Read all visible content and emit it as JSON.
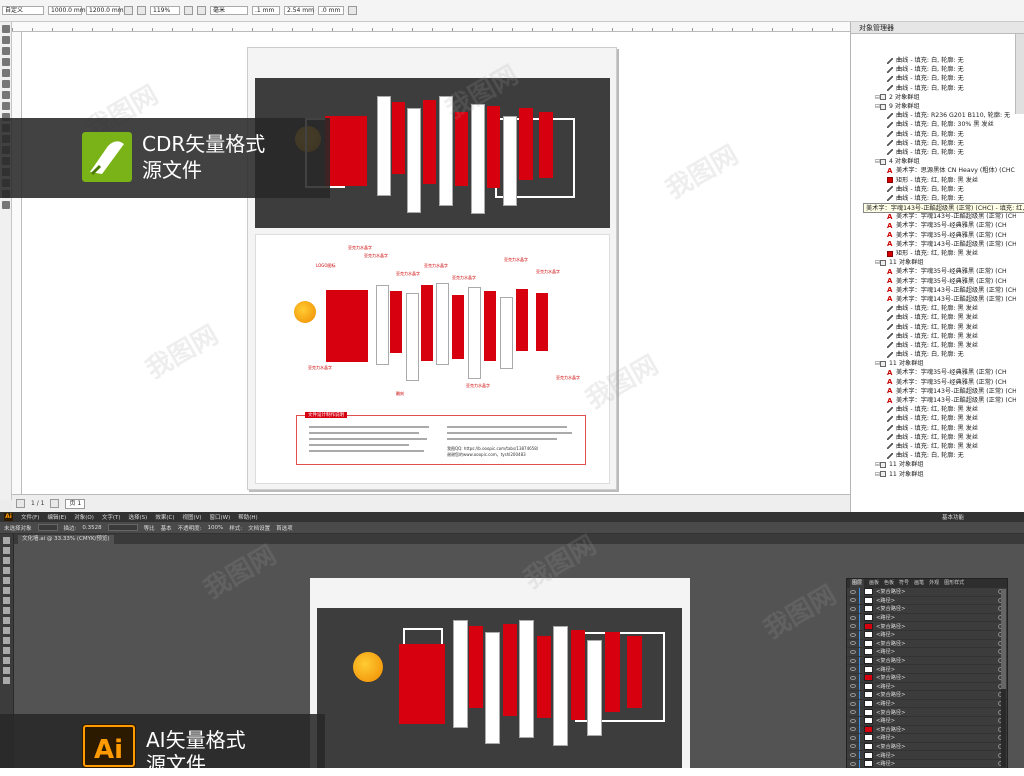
{
  "cdr": {
    "style_select": "自定义",
    "width_value": "1000.0 mm",
    "height_value": "1200.0 mm",
    "zoom_value": "119%",
    "units_value": "毫米",
    "nudge_value": ".1 mm",
    "dup_x": "2.54 mm",
    "dup_y": ".0 mm",
    "page_count": "1 / 1",
    "page_tab": "页 1",
    "badge_line1": "CDR矢量格式",
    "badge_line2": "源文件",
    "callouts": [
      "LOGO图标",
      "亚克力水晶字",
      "亚克力水晶字",
      "亚克力水晶字",
      "亚克力水晶字",
      "亚克力水晶字",
      "亚克力水晶字",
      "亚克力水晶字",
      "亚克力水晶字",
      "雕刻",
      "亚克力水晶字",
      "亚克力水晶字"
    ],
    "notes_title": "文件设计制作说明",
    "notes_contact": "我图QQ: https://b.ooopic.com/tabs/13874658/",
    "notes_contact2": "谢谢您的www.ooopic.com，tyshl200483"
  },
  "docker": {
    "title": "对象管理器",
    "tooltip": "美术字：字魂143号-正酷超级黑 (正常) (CHC) - 填充: 红, 轮",
    "rows": [
      {
        "t": "curve",
        "label": "曲线 - 填充: 白, 轮廓: 无"
      },
      {
        "t": "curve",
        "label": "曲线 - 填充: 白, 轮廓: 无"
      },
      {
        "t": "curve",
        "label": "曲线 - 填充: 白, 轮廓: 无"
      },
      {
        "t": "curve",
        "label": "曲线 - 填充: 白, 轮廓: 无"
      },
      {
        "t": "group",
        "label": "2 对象群组"
      },
      {
        "t": "group",
        "label": "9 对象群组"
      },
      {
        "t": "curve",
        "label": "曲线 - 填充: R236 G201 B110, 轮廓: 无"
      },
      {
        "t": "curve",
        "label": "曲线 - 填充: 白, 轮廓: 30% 黑 发丝"
      },
      {
        "t": "curve",
        "label": "曲线 - 填充: 白, 轮廓: 无"
      },
      {
        "t": "curve",
        "label": "曲线 - 填充: 白, 轮廓: 无"
      },
      {
        "t": "curve",
        "label": "曲线 - 填充: 白, 轮廓: 无"
      },
      {
        "t": "group",
        "label": "4 对象群组"
      },
      {
        "t": "text",
        "label": "美术字：思源黑体 CN Heavy (粗体) (CHC"
      },
      {
        "t": "rect",
        "label": "矩形 - 填充: 红, 轮廓: 黑 发丝"
      },
      {
        "t": "curve",
        "label": "曲线 - 填充: 白, 轮廓: 无"
      },
      {
        "t": "curve",
        "label": "曲线 - 填充: 白, 轮廓: 无"
      },
      {
        "t": "group",
        "label": "26 对象群组"
      },
      {
        "t": "text",
        "label": "美术字：字魂143号-正酷超级黑 (正常) (CHC) - 填充: 红, 轮"
      },
      {
        "t": "text",
        "label": "美术字：字魂35号-经典雅黑 (正常) (CH"
      },
      {
        "t": "text",
        "label": "美术字：字魂35号-经典雅黑 (正常) (CH"
      },
      {
        "t": "text",
        "label": "美术字：字魂143号-正酷超级黑 (正常) (CH"
      },
      {
        "t": "rect",
        "label": "矩形 - 填充: 红, 轮廓: 黑 发丝"
      },
      {
        "t": "group",
        "label": "11 对象群组"
      },
      {
        "t": "text",
        "label": "美术字：字魂35号-经典雅黑 (正常) (CH"
      },
      {
        "t": "text",
        "label": "美术字：字魂35号-经典雅黑 (正常) (CH"
      },
      {
        "t": "text",
        "label": "美术字：字魂143号-正酷超级黑 (正常) (CH"
      },
      {
        "t": "text",
        "label": "美术字：字魂143号-正酷超级黑 (正常) (CH"
      },
      {
        "t": "curve",
        "label": "曲线 - 填充: 红, 轮廓: 黑 发丝"
      },
      {
        "t": "curve",
        "label": "曲线 - 填充: 红, 轮廓: 黑 发丝"
      },
      {
        "t": "curve",
        "label": "曲线 - 填充: 红, 轮廓: 黑 发丝"
      },
      {
        "t": "curve",
        "label": "曲线 - 填充: 红, 轮廓: 黑 发丝"
      },
      {
        "t": "curve",
        "label": "曲线 - 填充: 红, 轮廓: 黑 发丝"
      },
      {
        "t": "curve",
        "label": "曲线 - 填充: 白, 轮廓: 无"
      },
      {
        "t": "group",
        "label": "11 对象群组"
      },
      {
        "t": "text",
        "label": "美术字：字魂35号-经典雅黑 (正常) (CH"
      },
      {
        "t": "text",
        "label": "美术字：字魂35号-经典雅黑 (正常) (CH"
      },
      {
        "t": "text",
        "label": "美术字：字魂143号-正酷超级黑 (正常) (CH"
      },
      {
        "t": "text",
        "label": "美术字：字魂143号-正酷超级黑 (正常) (CH"
      },
      {
        "t": "curve",
        "label": "曲线 - 填充: 红, 轮廓: 黑 发丝"
      },
      {
        "t": "curve",
        "label": "曲线 - 填充: 红, 轮廓: 黑 发丝"
      },
      {
        "t": "curve",
        "label": "曲线 - 填充: 红, 轮廓: 黑 发丝"
      },
      {
        "t": "curve",
        "label": "曲线 - 填充: 红, 轮廓: 黑 发丝"
      },
      {
        "t": "curve",
        "label": "曲线 - 填充: 红, 轮廓: 黑 发丝"
      },
      {
        "t": "curve",
        "label": "曲线 - 填充: 白, 轮廓: 无"
      },
      {
        "t": "group",
        "label": "11 对象群组"
      },
      {
        "t": "group",
        "label": "11 对象群组"
      }
    ]
  },
  "ai": {
    "menu": [
      "文件(F)",
      "编辑(E)",
      "对象(O)",
      "文字(T)",
      "选择(S)",
      "效果(C)",
      "视图(V)",
      "窗口(W)",
      "帮助(H)"
    ],
    "control": [
      "未选择对象",
      "描边:",
      "0.3528",
      "等比",
      "基本",
      "不透明度:",
      "100%",
      "样式:",
      "文档设置",
      "首选项"
    ],
    "workspace": "基本功能",
    "doc_tab": "文化墙.ai @ 33.33% (CMYK/预览)",
    "layers_tabs": [
      "图层",
      "画板",
      "色板",
      "符号",
      "画笔",
      "外观",
      "图形样式"
    ],
    "layer_rows": [
      "<复合路径>",
      "<路径>",
      "<复合路径>",
      "<路径>",
      "<复合路径>",
      "<路径>",
      "<复合路径>",
      "<路径>",
      "<复合路径>",
      "<路径>",
      "<复合路径>",
      "<路径>",
      "<复合路径>",
      "<路径>",
      "<复合路径>",
      "<路径>",
      "<复合路径>",
      "<路径>",
      "<复合路径>",
      "<路径>",
      "<路径>"
    ],
    "badge_line1": "AI矢量格式",
    "badge_line2": "源文件",
    "badge_logo": "Ai"
  },
  "colors": {
    "brand_red": "#d7000f",
    "dark_panel": "#3d3d3d",
    "ai_orange": "#ff9a00",
    "cdr_green": "#7ab317"
  }
}
